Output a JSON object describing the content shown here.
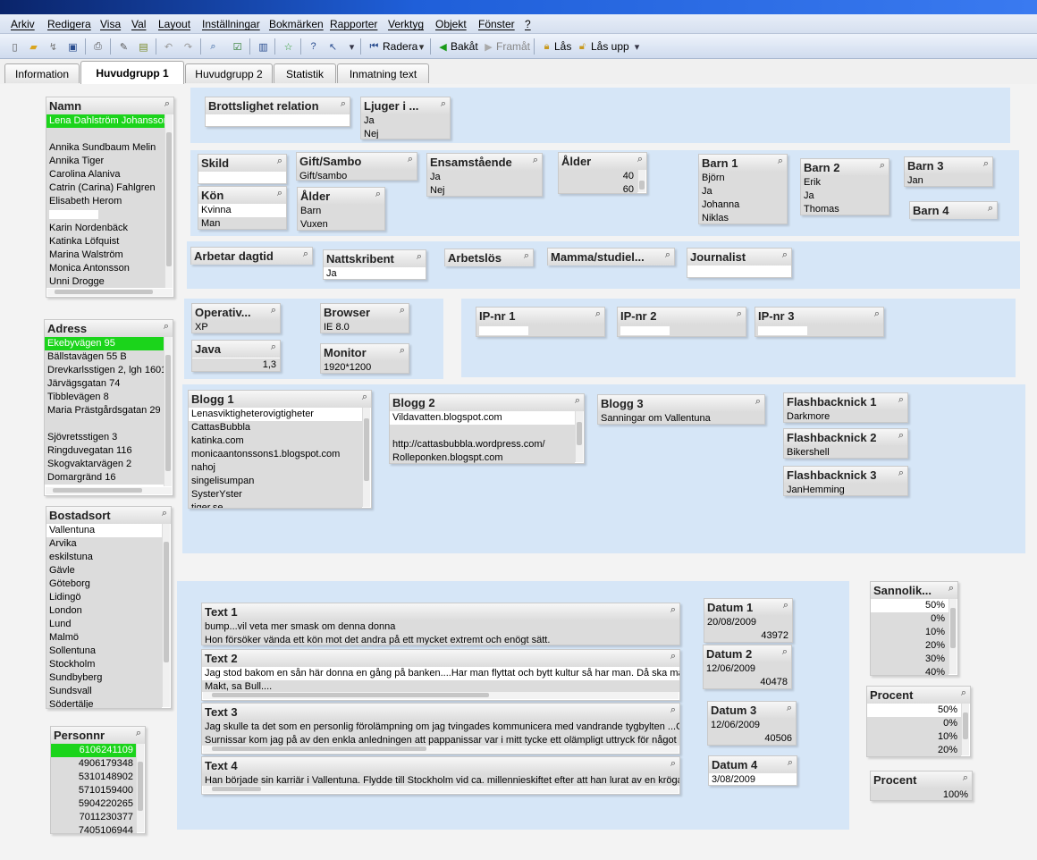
{
  "menu": [
    "Arkiv",
    "Redigera",
    "Visa",
    "Val",
    "Layout",
    "Inställningar",
    "Bokmärken",
    "Rapporter",
    "Verktyg",
    "Objekt",
    "Fönster",
    "?"
  ],
  "toolbar": {
    "radera": "Radera",
    "bakat": "Bakåt",
    "framat": "Framåt",
    "las": "Lås",
    "lasupp": "Lås upp"
  },
  "tabs": [
    "Information",
    "Huvudgrupp 1",
    "Huvudgrupp 2",
    "Statistik",
    "Inmatning text"
  ],
  "lists": {
    "namn": {
      "title": "Namn",
      "items": [
        "Lena Dahlström Johansson",
        "",
        "Annika Sundbaum Melin",
        "Annika Tiger",
        "Carolina Alaniva",
        "Catrin (Carina) Fahlgren",
        "Elisabeth Herom",
        "",
        "Karin Nordenbäck",
        "Katinka Löfquist",
        "Marina Walström",
        "Monica Antonsson",
        "Unni Drogge"
      ]
    },
    "adress": {
      "title": "Adress",
      "items": [
        "Ekebyvägen 95",
        "Bällstavägen 55 B",
        "Drevkarlsstigen 2, lgh 1601",
        "Järvägsgatan 74",
        "Tibblevägen 8",
        "Maria Prästgårdsgatan 29",
        "",
        "Sjövretsstigen 3",
        "Ringduvegatan 116",
        "Skogvaktarvägen 2",
        "Domargränd 16"
      ]
    },
    "bostadsort": {
      "title": "Bostadsort",
      "items": [
        "Vallentuna",
        "Arvika",
        "eskilstuna",
        "Gävle",
        "Göteborg",
        "Lidingö",
        "London",
        "Lund",
        "Malmö",
        "Sollentuna",
        "Stockholm",
        "Sundbyberg",
        "Sundsvall",
        "Södertälje"
      ]
    },
    "personnr": {
      "title": "Personnr",
      "items": [
        "6106241109",
        "4906179348",
        "5310148902",
        "5710159400",
        "5904220265",
        "7011230377",
        "7405106944"
      ]
    },
    "brott": {
      "title": "Brottslighet relation",
      "items": [
        ""
      ]
    },
    "ljuger": {
      "title": "Ljuger i ...",
      "items": [
        "Ja",
        "Nej"
      ]
    },
    "skild": {
      "title": "Skild",
      "items": [
        ""
      ]
    },
    "gift": {
      "title": "Gift/Sambo",
      "items": [
        "Gift/sambo"
      ]
    },
    "ensam": {
      "title": "Ensamstående",
      "items": [
        "Ja",
        "Nej"
      ]
    },
    "alder1": {
      "title": "Ålder",
      "items": [
        "40",
        "60"
      ]
    },
    "kon": {
      "title": "Kön",
      "items": [
        "Kvinna",
        "Man"
      ]
    },
    "alder2": {
      "title": "Ålder",
      "items": [
        "Barn",
        "Vuxen"
      ]
    },
    "barn1": {
      "title": "Barn 1",
      "items": [
        "Björn",
        "Ja",
        "Johanna",
        "Niklas"
      ]
    },
    "barn2": {
      "title": "Barn 2",
      "items": [
        "Erik",
        "Ja",
        "Thomas"
      ]
    },
    "barn3": {
      "title": "Barn 3",
      "items": [
        "Jan"
      ]
    },
    "barn4": {
      "title": "Barn 4",
      "items": []
    },
    "arbetar": {
      "title": "Arbetar dagtid",
      "items": []
    },
    "natt": {
      "title": "Nattskribent",
      "items": [
        "Ja"
      ]
    },
    "arblos": {
      "title": "Arbetslös",
      "items": []
    },
    "mamma": {
      "title": "Mamma/studiel...",
      "items": []
    },
    "journ": {
      "title": "Journalist",
      "items": [
        ""
      ]
    },
    "oper": {
      "title": "Operativ...",
      "items": [
        "XP"
      ]
    },
    "browser": {
      "title": "Browser",
      "items": [
        "IE 8.0"
      ]
    },
    "java": {
      "title": "Java",
      "items": [
        "1,3"
      ]
    },
    "monitor": {
      "title": "Monitor",
      "items": [
        "1920*1200"
      ]
    },
    "ip1": {
      "title": "IP-nr 1",
      "items": [
        ""
      ]
    },
    "ip2": {
      "title": "IP-nr 2",
      "items": [
        ""
      ]
    },
    "ip3": {
      "title": "IP-nr 3",
      "items": [
        ""
      ]
    },
    "blogg1": {
      "title": "Blogg 1",
      "items": [
        "Lenasviktigheterovigtigheter",
        "CattasBubbla",
        "katinka.com",
        "monicaantonssons1.blogspot.com",
        "nahoj",
        "singelisumpan",
        "SysterYster",
        "tiger.se"
      ]
    },
    "blogg2": {
      "title": "Blogg 2",
      "items": [
        "Vildavatten.blogspot.com",
        "",
        "http://cattasbubbla.wordpress.com/",
        "Rolleponken.blogspt.com"
      ]
    },
    "blogg3": {
      "title": "Blogg 3",
      "items": [
        "Sanningar om Vallentuna"
      ]
    },
    "fb1": {
      "title": "Flashbacknick 1",
      "items": [
        "Darkmore"
      ]
    },
    "fb2": {
      "title": "Flashbacknick 2",
      "items": [
        "Bikershell"
      ]
    },
    "fb3": {
      "title": "Flashbacknick 3",
      "items": [
        "JanHemming"
      ]
    },
    "text1": {
      "title": "Text 1",
      "items": [
        "bump...vil veta mer smask om denna donna",
        "Hon försöker vända ett kön mot det andra på ett mycket extremt och enögt sätt."
      ]
    },
    "text2": {
      "title": "Text 2",
      "items": [
        " Jag stod bakom en sån här donna en gång på banken....Har man flyttat och bytt kultur så har man. Då ska man",
        "Makt, sa Bull...."
      ]
    },
    "text3": {
      "title": "Text 3",
      "items": [
        " Jag skulle ta det som en personlig förolämpning om jag tvingades kommunicera med vandrande tygbylten ...O",
        "Surnissar kom jag på av den enkla anledningen att pappanissar var i mitt tycke ett olämpligt uttryck för något s"
      ]
    },
    "text4": {
      "title": "Text 4",
      "items": [
        "Han började sin karriär i Vallentuna. Flydde till Stockholm vid ca. millennieskiftet efter att han lurat av en krögar"
      ]
    },
    "datum1": {
      "title": "Datum 1",
      "items": [
        "20/08/2009",
        "43972"
      ]
    },
    "datum2": {
      "title": "Datum 2",
      "items": [
        "12/06/2009",
        "40478"
      ]
    },
    "datum3": {
      "title": "Datum 3",
      "items": [
        "12/06/2009",
        "40506"
      ]
    },
    "datum4": {
      "title": "Datum 4",
      "items": [
        "3/08/2009"
      ]
    },
    "sannolik": {
      "title": "Sannolik...",
      "items": [
        "50%",
        "0%",
        "10%",
        "20%",
        "30%",
        "40%"
      ]
    },
    "procent1": {
      "title": "Procent",
      "items": [
        "50%",
        "0%",
        "10%",
        "20%"
      ]
    },
    "procent2": {
      "title": "Procent",
      "items": [
        "100%"
      ]
    }
  }
}
